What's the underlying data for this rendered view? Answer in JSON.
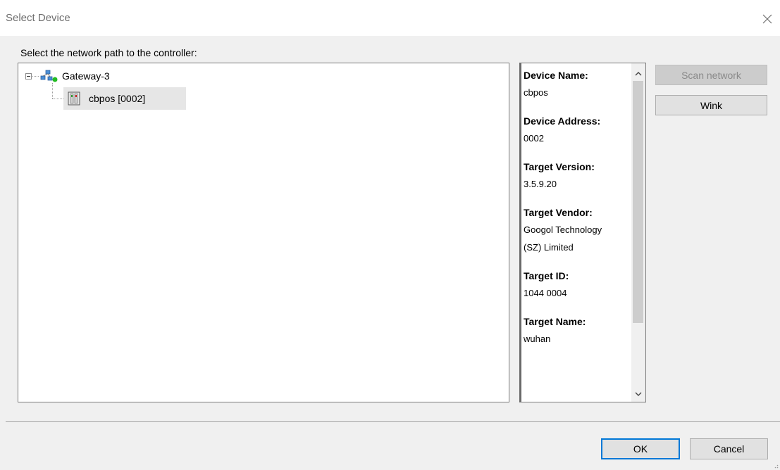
{
  "dialog": {
    "title": "Select Device"
  },
  "tree": {
    "prompt": "Select the network path to the controller:",
    "root_label": "Gateway-3",
    "child_label": "cbpos [0002]"
  },
  "device_info": [
    {
      "label": "Device Name:",
      "value": "cbpos"
    },
    {
      "label": "Device Address:",
      "value": "0002"
    },
    {
      "label": "Target Version:",
      "value": "3.5.9.20"
    },
    {
      "label": "Target Vendor:",
      "value": "Googol Technology\n(SZ) Limited"
    },
    {
      "label": "Target ID:",
      "value": "1044 0004"
    },
    {
      "label": "Target Name:",
      "value": "wuhan"
    }
  ],
  "buttons": {
    "scan_network": "Scan network",
    "wink": "Wink",
    "ok": "OK",
    "cancel": "Cancel"
  },
  "colors": {
    "accent": "#0078d7",
    "status_online": "#22bb22"
  },
  "icons": {
    "close": "close-icon",
    "gateway": "network-gateway-icon",
    "device": "plc-device-icon"
  }
}
